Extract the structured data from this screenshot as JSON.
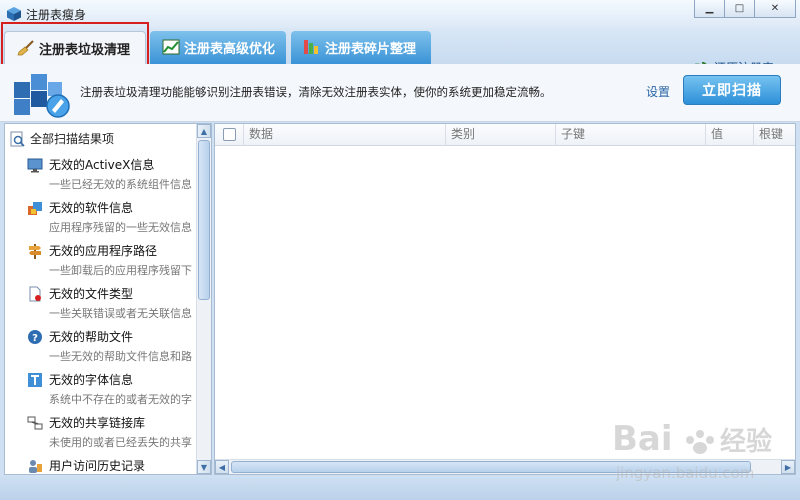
{
  "window": {
    "title": "注册表瘦身",
    "controls": [
      "minimize",
      "maximize",
      "close"
    ]
  },
  "tabs": [
    {
      "label": "注册表垃圾清理",
      "icon": "broom-icon",
      "active": true
    },
    {
      "label": "注册表高级优化",
      "icon": "chart-icon",
      "active": false
    },
    {
      "label": "注册表碎片整理",
      "icon": "defrag-icon",
      "active": false
    }
  ],
  "restore_link": "还原注册表",
  "banner": {
    "description": "注册表垃圾清理功能能够识别注册表错误，清除无效注册表实体，使你的系统更加稳定流畅。",
    "settings": "设置",
    "scan_button": "立即扫描"
  },
  "tree": {
    "root": "全部扫描结果项",
    "items": [
      {
        "title": "无效的ActiveX信息",
        "subtitle": "一些已经无效的系统组件信息",
        "icon": "monitor-icon"
      },
      {
        "title": "无效的软件信息",
        "subtitle": "应用程序残留的一些无效信息",
        "icon": "software-icon"
      },
      {
        "title": "无效的应用程序路径",
        "subtitle": "一些卸载后的应用程序残留下",
        "icon": "signpost-icon"
      },
      {
        "title": "无效的文件类型",
        "subtitle": "一些关联错误或者无关联信息",
        "icon": "file-icon"
      },
      {
        "title": "无效的帮助文件",
        "subtitle": "一些无效的帮助文件信息和路",
        "icon": "help-icon"
      },
      {
        "title": "无效的字体信息",
        "subtitle": "系统中不存在的或者无效的字",
        "icon": "font-icon"
      },
      {
        "title": "无效的共享链接库",
        "subtitle": "未使用的或者已经丢失的共享",
        "icon": "link-icon"
      },
      {
        "title": "用户访问历史记录",
        "subtitle": "",
        "icon": "history-icon"
      }
    ]
  },
  "grid": {
    "columns": [
      "数据",
      "类别",
      "子键",
      "值",
      "根键"
    ]
  },
  "watermark": {
    "brand": "Bai",
    "brand_suffix": "经验",
    "url": "jingyan.baidu.com"
  },
  "colors": {
    "accent": "#3a93d6",
    "highlight_box": "#d62020",
    "link": "#2966a8"
  }
}
